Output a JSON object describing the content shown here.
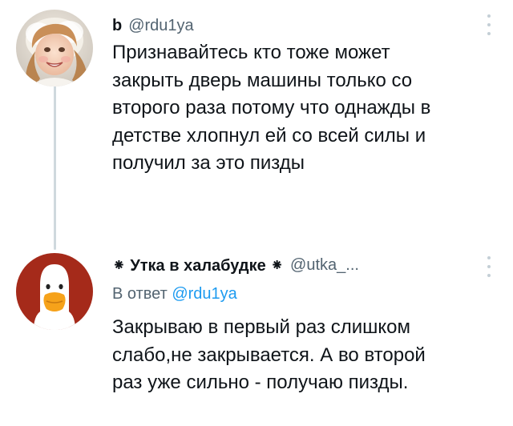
{
  "tweets": [
    {
      "author": {
        "name": "b",
        "handle": "@rdu1ya"
      },
      "text_lines": [
        "Признавайтесь кто тоже может",
        "закрыть дверь машины только со",
        "второго раза потому что однажды в",
        "детстве хлопнул ей со всей силы и",
        "получил за это пизды"
      ],
      "avatar_icon": "child-photo-avatar",
      "menu_icon": "more-options-icon"
    },
    {
      "author": {
        "name": "⁕ Утка в халабудке ⁕",
        "handle": "@utka_..."
      },
      "reply_prefix": "В ответ",
      "reply_mention": "@rdu1ya",
      "text_lines": [
        "Закрываю в первый раз слишком",
        "слабо,не закрывается. А во второй",
        "раз уже сильно - получаю пизды."
      ],
      "avatar_icon": "duck-avatar",
      "menu_icon": "more-options-icon"
    }
  ],
  "colors": {
    "text": "#0f1419",
    "secondary": "#536471",
    "link": "#1d9bf0",
    "thread_line": "#cfd9de",
    "duck_background": "#a52a1a"
  }
}
